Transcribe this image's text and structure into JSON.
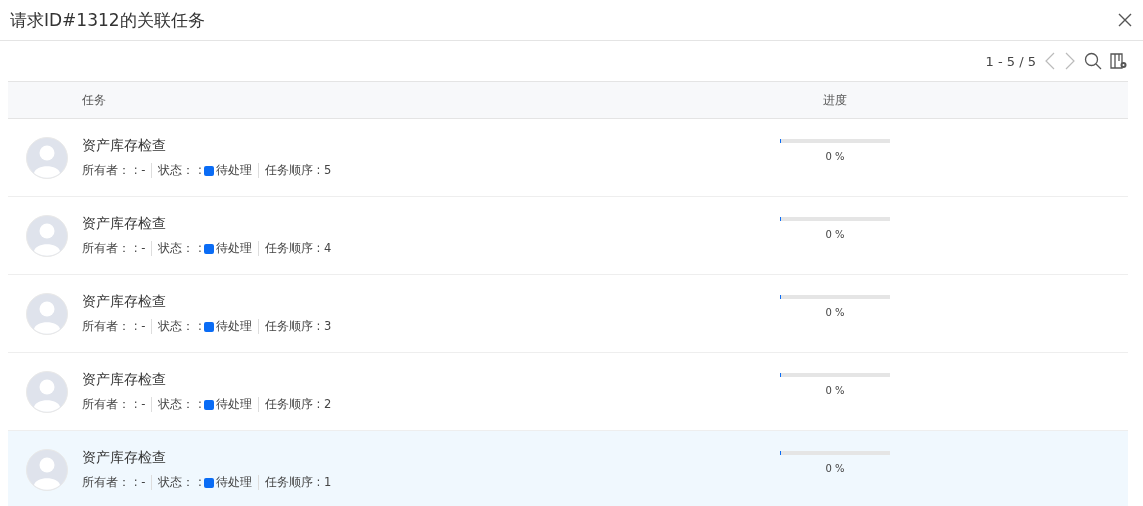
{
  "dialog": {
    "title": "请求ID#1312的关联任务"
  },
  "toolbar": {
    "range": "1 - 5 / 5"
  },
  "table": {
    "columns": [
      "任务",
      "进度"
    ],
    "rows": [
      {
        "name": "资产库存检查",
        "owner": "所有者： : -",
        "status_label": "状态： :",
        "status": "待处理",
        "color": "#0a6cf5",
        "order": "任务顺序 : 5",
        "level": 0,
        "progress": "0 %",
        "selected": false
      },
      {
        "name": "资产库存检查",
        "owner": "所有者： : -",
        "status_label": "状态： :",
        "status": "待处理",
        "color": "#0a6cf5",
        "order": "任务顺序 : 4",
        "level": 0,
        "progress": "0 %",
        "selected": false
      },
      {
        "name": "资产库存检查",
        "owner": "所有者： : -",
        "status_label": "状态： :",
        "status": "待处理",
        "color": "#0a6cf5",
        "order": "任务顺序 : 3",
        "level": 0,
        "progress": "0 %",
        "selected": false
      },
      {
        "name": "资产库存检查",
        "owner": "所有者： : -",
        "status_label": "状态： :",
        "status": "待处理",
        "color": "#0a6cf5",
        "order": "任务顺序 : 2",
        "level": 0,
        "progress": "0 %",
        "selected": false
      },
      {
        "name": "资产库存检查",
        "owner": "所有者： : -",
        "status_label": "状态： :",
        "status": "待处理",
        "color": "#0a6cf5",
        "order": "任务顺序 : 1",
        "level": 0,
        "progress": "0 %",
        "selected": true
      }
    ]
  }
}
